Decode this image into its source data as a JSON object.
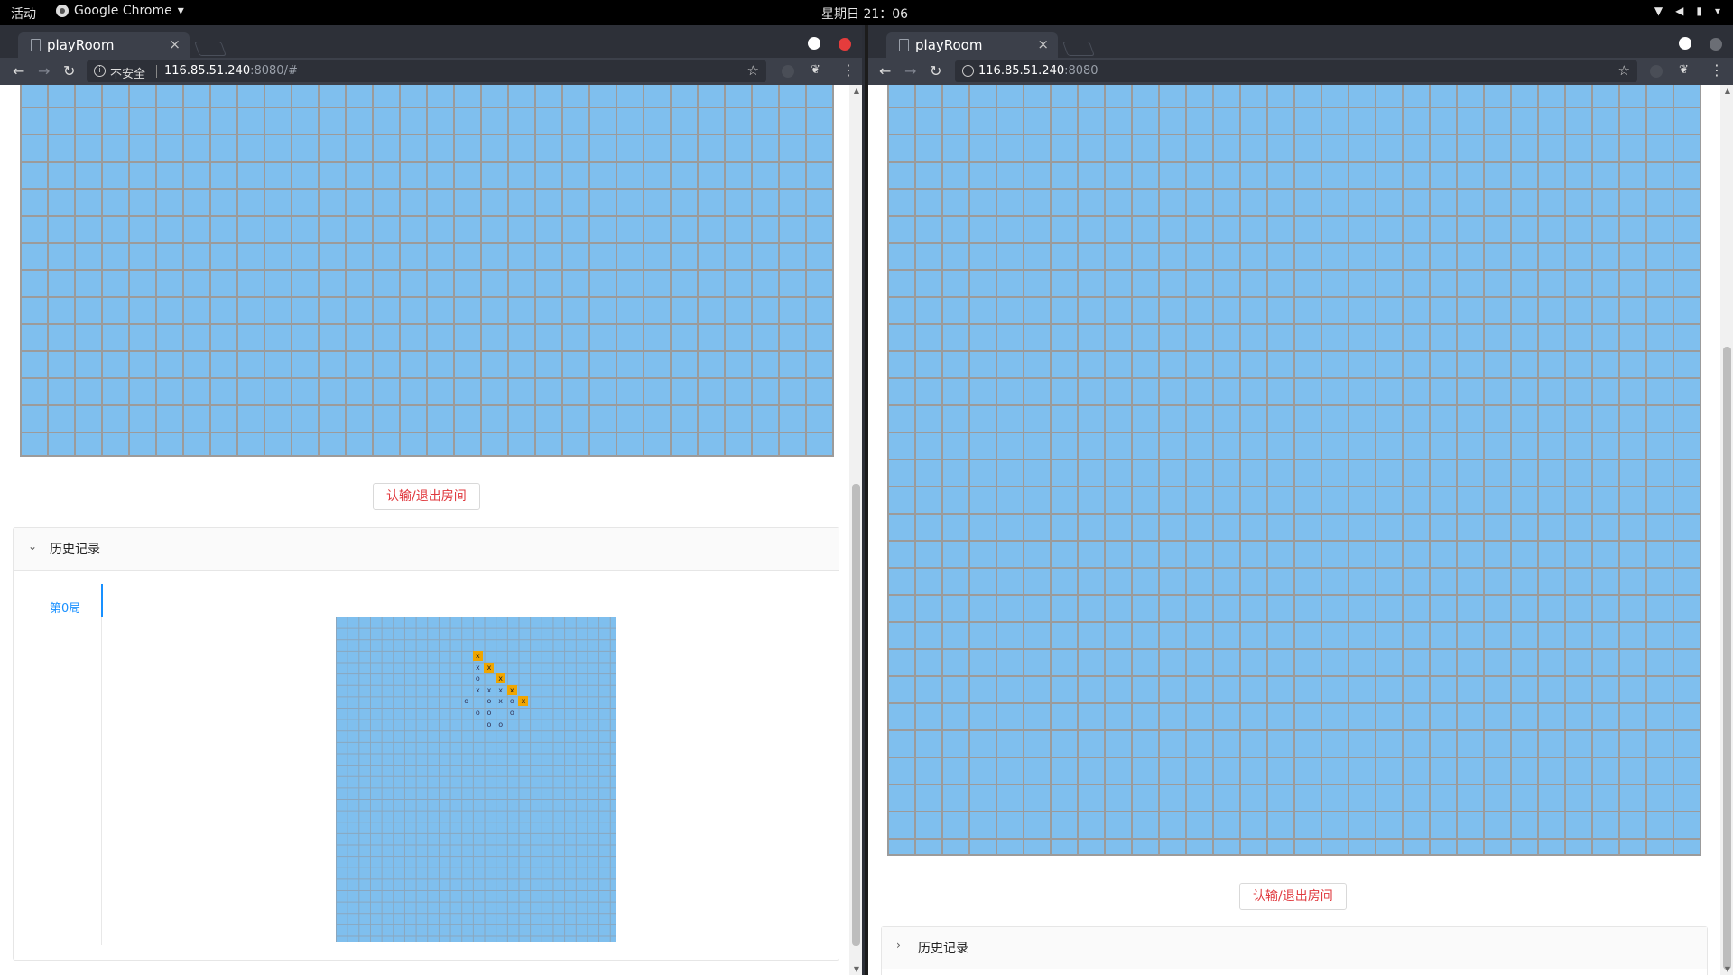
{
  "topbar": {
    "activities": "活动",
    "app_name": "Google Chrome",
    "clock": "星期日 21：06"
  },
  "left_window": {
    "tab_title": "playRoom",
    "security_label": "不安全",
    "url_host": "116.85.51.240",
    "url_rest": ":8080/#",
    "surrender_label": "认输/退出房间",
    "history_label": "历史记录",
    "history_expanded": true,
    "history_tabs": [
      "第0局"
    ],
    "history_marks": [
      {
        "r": 3,
        "c": 12,
        "t": "x",
        "hl": true
      },
      {
        "r": 4,
        "c": 12,
        "t": "x",
        "hl": false
      },
      {
        "r": 4,
        "c": 13,
        "t": "x",
        "hl": true
      },
      {
        "r": 5,
        "c": 12,
        "t": "o",
        "hl": false
      },
      {
        "r": 5,
        "c": 14,
        "t": "x",
        "hl": true
      },
      {
        "r": 6,
        "c": 12,
        "t": "x",
        "hl": false
      },
      {
        "r": 6,
        "c": 13,
        "t": "x",
        "hl": false
      },
      {
        "r": 6,
        "c": 14,
        "t": "x",
        "hl": false
      },
      {
        "r": 6,
        "c": 15,
        "t": "x",
        "hl": true
      },
      {
        "r": 7,
        "c": 11,
        "t": "o",
        "hl": false
      },
      {
        "r": 7,
        "c": 13,
        "t": "o",
        "hl": false
      },
      {
        "r": 7,
        "c": 14,
        "t": "x",
        "hl": false
      },
      {
        "r": 7,
        "c": 15,
        "t": "o",
        "hl": false
      },
      {
        "r": 7,
        "c": 16,
        "t": "x",
        "hl": true
      },
      {
        "r": 8,
        "c": 12,
        "t": "o",
        "hl": false
      },
      {
        "r": 8,
        "c": 13,
        "t": "o",
        "hl": false
      },
      {
        "r": 8,
        "c": 15,
        "t": "o",
        "hl": false
      },
      {
        "r": 9,
        "c": 13,
        "t": "o",
        "hl": false
      },
      {
        "r": 9,
        "c": 14,
        "t": "o",
        "hl": false
      }
    ]
  },
  "right_window": {
    "tab_title": "playRoom",
    "url_host": "116.85.51.240",
    "url_rest": ":8080",
    "surrender_label": "认输/退出房间",
    "history_label": "历史记录",
    "history_expanded": false
  },
  "icons": {
    "tab_close": "×",
    "back": "←",
    "forward": "→",
    "reload": "↻",
    "star": "☆",
    "menu": "⋮",
    "chev_down": "⌄",
    "chev_right": "›",
    "caret_down": "▾"
  }
}
